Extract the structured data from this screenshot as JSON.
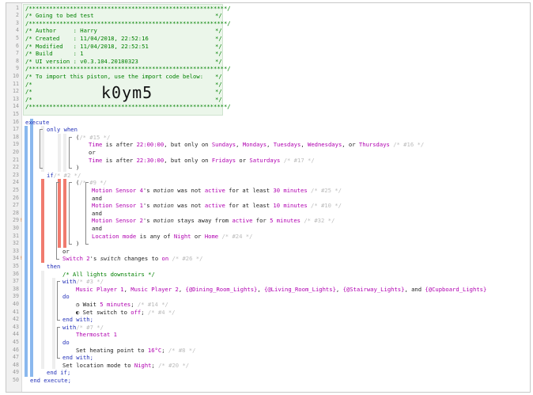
{
  "header": {
    "star_line": "/**********************************************************/",
    "rows": [
      {
        "text": "/* Going to bed test",
        "end": "*/"
      },
      {
        "text": "/* Author     : Harry",
        "end": "*/"
      },
      {
        "text": "/* Created    : 11/04/2018, 22:52:16",
        "end": "*/"
      },
      {
        "text": "/* Modified   : 11/04/2018, 22:52:51",
        "end": "*/"
      },
      {
        "text": "/* Build      : 1",
        "end": "*/"
      },
      {
        "text": "/* UI version : v0.3.104.20180323",
        "end": "*/"
      },
      {
        "text": "/* To import this piston, use the import code below:",
        "end": "*/"
      },
      {
        "text": "/*",
        "end": "*/"
      },
      {
        "text": "/*",
        "end": "*/"
      },
      {
        "text": "/*",
        "end": "*/"
      }
    ],
    "import_code": "k0ym5"
  },
  "line_numbers": [
    "1",
    "2",
    "3",
    "4",
    "5",
    "6",
    "7",
    "8",
    "9",
    "10",
    "11",
    "12",
    "13",
    "14",
    "15",
    "16",
    "17",
    "18",
    "19",
    "20",
    "21",
    "22",
    "23",
    "24",
    "25",
    "26",
    "27",
    "28",
    "29",
    "30",
    "31",
    "32",
    "33",
    "34",
    "35",
    "36",
    "37",
    "38",
    "39",
    "40",
    "41",
    "42",
    "43",
    "44",
    "45",
    "46",
    "47",
    "48",
    "49",
    "50"
  ],
  "gutter_marks": {
    "m29": "!",
    "m34": "!"
  },
  "code": {
    "execute": "execute",
    "only_when": "only when",
    "open_paren": "(",
    "close_paren": ")",
    "n15": "/* #15 */",
    "l19": {
      "a": "Time",
      "b": " is after ",
      "c": "22:00:00",
      "d": ", but only on ",
      "e": "Sundays",
      "f": ", ",
      "g": "Mondays",
      "h": ", ",
      "i": "Tuesdays",
      "j": ", ",
      "k": "Wednesdays",
      "l": ", or ",
      "m": "Thursdays",
      "n": " /* #16 */"
    },
    "or": "or",
    "l21": {
      "a": "Time",
      "b": " is after ",
      "c": "22:30:00",
      "d": ", but only on ",
      "e": "Fridays",
      "f": " or ",
      "g": "Saturdays",
      "h": " /* #17 */"
    },
    "if": "if",
    "n2": "/* #2 */",
    "n9": "/* #9 */",
    "l25": {
      "a": "Motion Sensor 4",
      "b": "'s ",
      "c": "motion",
      "d": " was not ",
      "e": "active",
      "f": " for at least ",
      "g": "30 minutes",
      "h": " /* #25 */"
    },
    "and": "and",
    "l27": {
      "a": "Motion Sensor 1",
      "b": "'s ",
      "c": "motion",
      "d": " was not ",
      "e": "active",
      "f": " for at least ",
      "g": "10 minutes",
      "h": " /* #10 */"
    },
    "l29": {
      "a": "Motion Sensor 2",
      "b": "'s ",
      "c": "motion",
      "d": " stays away from ",
      "e": "active",
      "f": " for ",
      "g": "5 minutes",
      "h": " /* #32 */"
    },
    "l31": {
      "a": "Location mode",
      "b": " is any of ",
      "c": "Night",
      "d": " or ",
      "e": "Home",
      "f": " /* #24 */"
    },
    "l34": {
      "a": "Switch 2",
      "b": "'s ",
      "c": "switch",
      "d": " changes to ",
      "e": "on",
      "f": " /* #26 */"
    },
    "then": "then",
    "l36": "/* All lights downstairs */",
    "with": "with",
    "n3": "/* #3 */",
    "l38": {
      "a": "Music Player 1",
      "b": ", ",
      "c": "Music Player 2",
      "d": ", ",
      "e": "{@Dining_Room_Lights}",
      "f": ", ",
      "g": "{@Living_Room_Lights}",
      "h": ", ",
      "i": "{@Stairway_Lights}",
      "j": ", and ",
      "k": "{@Cupboard_Lights}"
    },
    "do": "do",
    "l40": {
      "icon": "◷",
      "a": " Wait ",
      "b": "5 minutes",
      "c": "; ",
      "d": "/* #14 */"
    },
    "l41": {
      "icon": "◐",
      "a": " Set switch to ",
      "b": "off",
      "c": "; ",
      "d": "/* #4 */"
    },
    "end_with": "end with;",
    "n7": "/* #7 */",
    "l44": "Thermostat 1",
    "l46": {
      "a": "Set heating point to ",
      "b": "16°C",
      "c": "; ",
      "d": "/* #8 */"
    },
    "l48": {
      "a": "Set location mode to ",
      "b": "Night",
      "c": "; ",
      "d": "/* #20 */"
    },
    "end_if": "end if;",
    "end_execute": "end execute;"
  },
  "colors": {
    "bar_blue": "#8ab8ee",
    "bar_red": "#f07b6e",
    "header_bg": "#ebf6ea",
    "comment": "#008000"
  }
}
